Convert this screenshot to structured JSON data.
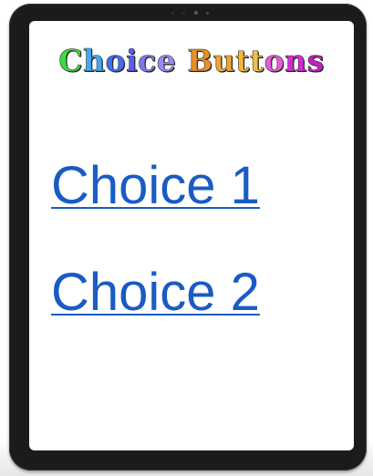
{
  "header": {
    "title": "Choice Buttons",
    "title_letter_colors": [
      "#3fd93f",
      "#3fa9f5",
      "#3f6ff5",
      "#5a5af5",
      "#7a7af5",
      "#9a8af5",
      "#ffffff",
      "#e8902a",
      "#f2a431",
      "#f5b63a",
      "#f0c042",
      "#e85ad8",
      "#d42ad4",
      "#c21fc2"
    ]
  },
  "choices": [
    {
      "label": "Choice 1"
    },
    {
      "label": "Choice 2"
    }
  ],
  "colors": {
    "link": "#1a5bc4",
    "device_frame": "#1b1b1b",
    "screen": "#ffffff"
  }
}
